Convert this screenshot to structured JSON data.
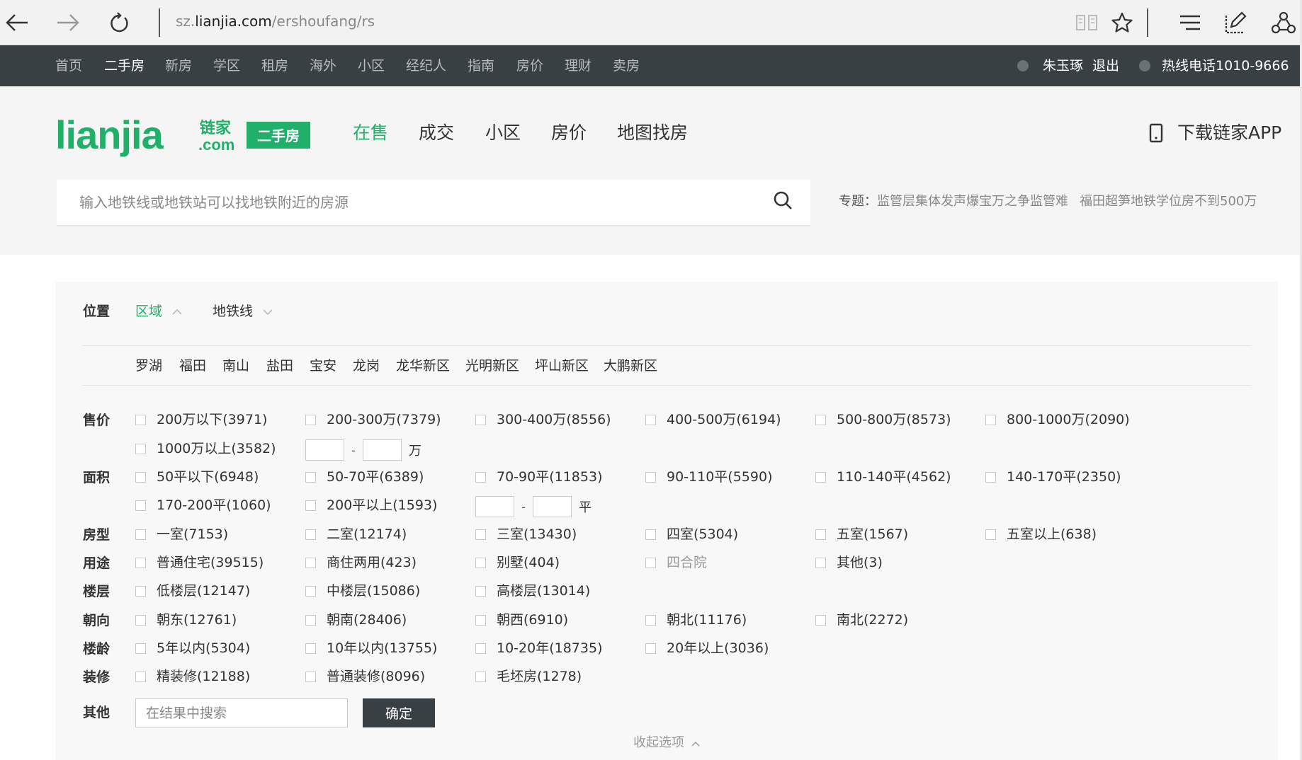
{
  "browser": {
    "url_prefix": "sz.",
    "url_host": "lianjia.com",
    "url_path": "/ershoufang/rs"
  },
  "topnav": {
    "items": [
      "首页",
      "二手房",
      "新房",
      "学区",
      "租房",
      "海外",
      "小区",
      "经纪人",
      "指南",
      "房价",
      "理财",
      "卖房"
    ],
    "active_index": 1,
    "user": "朱玉琢",
    "logout": "退出",
    "hotline": "热线电话1010-9666"
  },
  "header": {
    "logo_text": "lianjia",
    "logo_cn": "链家",
    "logo_com": ".com",
    "badge": "二手房",
    "tabs": [
      "在售",
      "成交",
      "小区",
      "房价",
      "地图找房"
    ],
    "active_tab": 0,
    "download": "下载链家APP",
    "search_placeholder": "输入地铁线或地铁站可以找地铁附近的房源",
    "topics_label": "专题：",
    "topics": [
      "监管层集体发声爆宝万之争监管难",
      "福田超笋地铁学位房不到500万"
    ]
  },
  "filters": {
    "position": {
      "label": "位置",
      "tabs": [
        "区域",
        "地铁线"
      ],
      "districts": [
        "罗湖",
        "福田",
        "南山",
        "盐田",
        "宝安",
        "龙岗",
        "龙华新区",
        "光明新区",
        "坪山新区",
        "大鹏新区"
      ]
    },
    "price": {
      "label": "售价",
      "options": [
        "200万以下(3971)",
        "200-300万(7379)",
        "300-400万(8556)",
        "400-500万(6194)",
        "500-800万(8573)",
        "800-1000万(2090)",
        "1000万以上(3582)"
      ],
      "range_dash": "-",
      "range_unit": "万"
    },
    "area": {
      "label": "面积",
      "options": [
        "50平以下(6948)",
        "50-70平(6389)",
        "70-90平(11853)",
        "90-110平(5590)",
        "110-140平(4562)",
        "140-170平(2350)",
        "170-200平(1060)",
        "200平以上(1593)"
      ],
      "range_dash": "-",
      "range_unit": "平"
    },
    "layout": {
      "label": "房型",
      "options": [
        "一室(7153)",
        "二室(12174)",
        "三室(13430)",
        "四室(5304)",
        "五室(1567)",
        "五室以上(638)"
      ]
    },
    "usage": {
      "label": "用途",
      "options": [
        "普通住宅(39515)",
        "商住两用(423)",
        "别墅(404)",
        "四合院",
        "其他(3)"
      ]
    },
    "floor": {
      "label": "楼层",
      "options": [
        "低楼层(12147)",
        "中楼层(15086)",
        "高楼层(13014)"
      ]
    },
    "orientation": {
      "label": "朝向",
      "options": [
        "朝东(12761)",
        "朝南(28406)",
        "朝西(6910)",
        "朝北(11176)",
        "南北(2272)"
      ]
    },
    "age": {
      "label": "楼龄",
      "options": [
        "5年以内(5304)",
        "10年以内(13755)",
        "10-20年(18735)",
        "20年以上(3036)"
      ]
    },
    "decoration": {
      "label": "装修",
      "options": [
        "精装修(12188)",
        "普通装修(8096)",
        "毛坯房(1278)"
      ]
    },
    "other": {
      "label": "其他",
      "placeholder": "在结果中搜索",
      "confirm": "确定"
    },
    "collapse": "收起选项"
  },
  "colors": {
    "accent_green": "#21b06a",
    "nav_dark": "#394043"
  }
}
